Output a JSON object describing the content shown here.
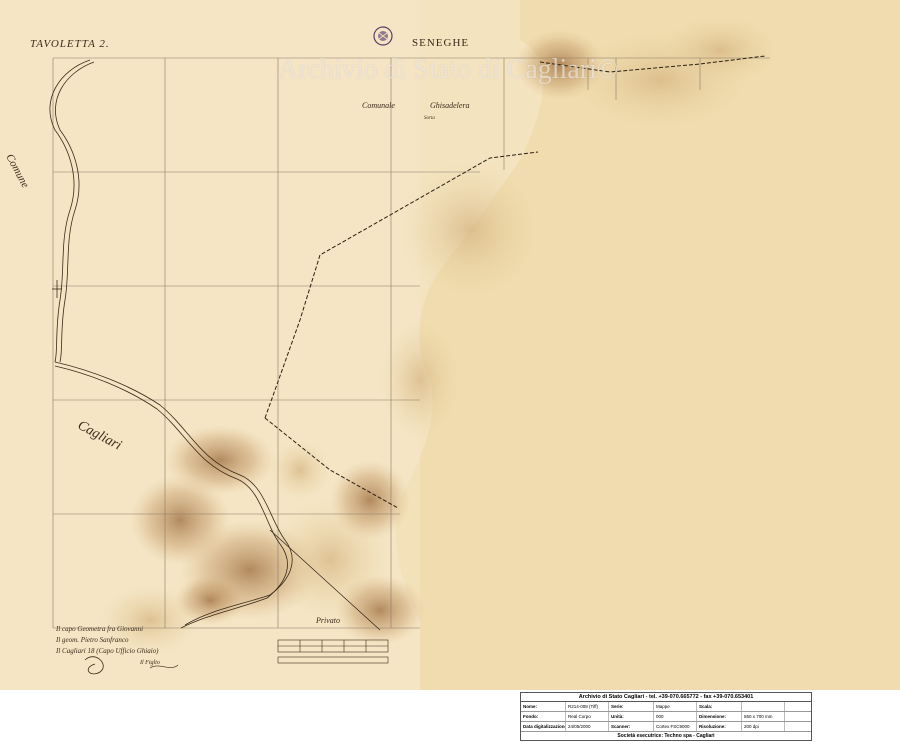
{
  "map": {
    "sheet_title": "TAVOLETTA 2.",
    "top_label": "SENEGHE",
    "watermark": "Archivio di Stato di Cagliari©",
    "label_comunale": "Comunale",
    "label_ghisadelera": "Ghisadelera",
    "label_sorta": "Sorta",
    "label_comune": "Comune",
    "label_cagliari": "Cagliari",
    "label_privato": "Privato",
    "signature_lines": [
      "Il capo Geometra fra Giovanni",
      "Il geom. Pietro Sanfranco",
      "Il Cagliari 18 (Capo Ufficio Ghiaio)",
      "Il Figlio"
    ]
  },
  "footer": {
    "title": "Archivio di Stato Cagliari - tel. +39-070.665772 - fax +39-070.653401",
    "rows": [
      [
        {
          "label": "Nome:",
          "value": "R214-008 (Tiff)"
        },
        {
          "label": "Serie:",
          "value": "Mappe"
        },
        {
          "label": "Scala:",
          "value": ""
        }
      ],
      [
        {
          "label": "Fondo:",
          "value": "Real Corpo"
        },
        {
          "label": "Unità:",
          "value": "000"
        },
        {
          "label": "Dimensione:",
          "value": "550 x 700 mm"
        }
      ],
      [
        {
          "label": "Data digitalizzazione:",
          "value": "24/05/2000"
        },
        {
          "label": "Scanner:",
          "value": "Cortex FSC9000"
        },
        {
          "label": "Risoluzione:",
          "value": "200 dpi"
        }
      ]
    ],
    "bottom": "Società esecutrice: Techno spa - Cagliari"
  },
  "colors": {
    "paper": "#efdcb0",
    "stain": "#b9875a",
    "ink": "#3a2a1a",
    "grid": "#8a7a68"
  }
}
